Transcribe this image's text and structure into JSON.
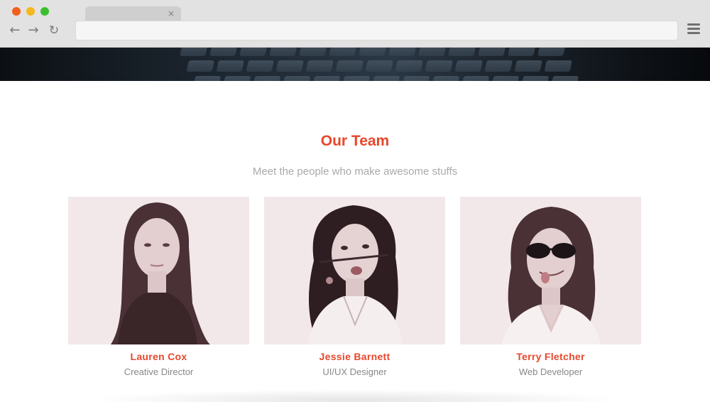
{
  "browser": {
    "tab_close": "×",
    "nav": {
      "back": "←",
      "forward": "→",
      "reload": "↻"
    }
  },
  "team": {
    "title": "Our Team",
    "subtitle": "Meet the people who make awesome stuffs",
    "members": [
      {
        "name": "Lauren Cox",
        "role": "Creative Director"
      },
      {
        "name": "Jessie Barnett",
        "role": "UI/UX Designer"
      },
      {
        "name": "Terry Fletcher",
        "role": "Web Developer"
      }
    ]
  },
  "colors": {
    "accent": "#e8472c",
    "muted_text": "#888888",
    "photo_tint": "#f1e7e9"
  }
}
